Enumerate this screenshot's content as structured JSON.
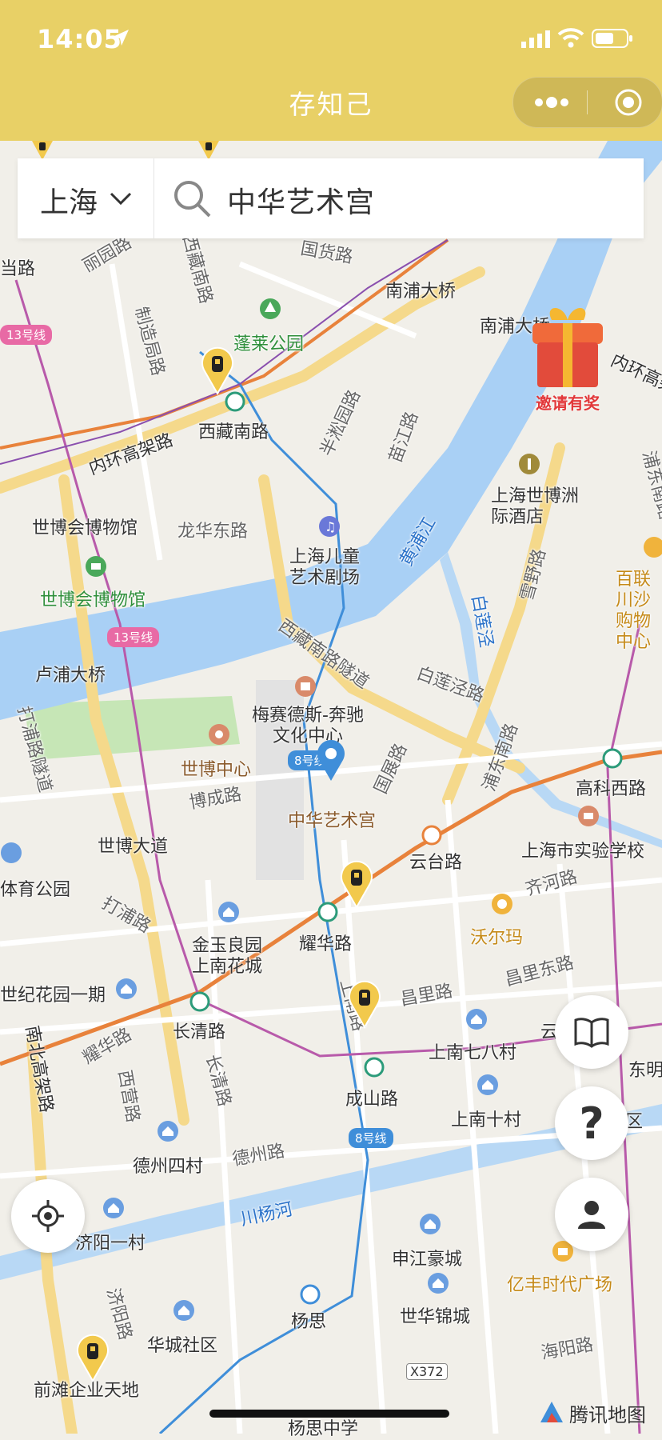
{
  "status_bar": {
    "time": "14:05"
  },
  "title_bar": {
    "title": "存知己"
  },
  "search": {
    "city": "上海",
    "query": "中华艺术宫"
  },
  "promo": {
    "label": "邀请有奖"
  },
  "map": {
    "attribution": "腾讯地图",
    "labels": {
      "dangpan": "当路",
      "liyuan": "丽园路",
      "zhizao": "制造局路",
      "xizang_nan": "西藏南路",
      "penglai": "蓬莱公园",
      "guohuo": "国货路",
      "nanpu_bridge": "南浦大桥",
      "nanpu_bridge2": "南浦大桥",
      "banjing": "半淞园路",
      "yuanjiang": "苗江路",
      "neihuan": "内环高架路",
      "neihuan2": "内环高架",
      "xizang_station": "西藏南路",
      "shibo_museum_a": "世博会博物馆",
      "longhua_e": "龙华东路",
      "shibo_museum_b": "世博会博物馆",
      "huangpu": "黄浦江",
      "children_theatre": "上海儿童艺术剧场",
      "expo_hotel": "上海世博洲际酒店",
      "xueye": "雪野路",
      "bailianjing_r": "白莲泾",
      "puneast": "浦东南路",
      "bailianjing_road": "白莲泾路",
      "lupu": "卢浦大桥",
      "xizang_tunnel": "西藏南路隧道",
      "benz": "梅赛德斯-奔驰文化中心",
      "shibo_center": "世博中心",
      "bocheng": "博成路",
      "guozhan": "国展路",
      "china_art": "中华艺术宫",
      "shibo_ave": "世博大道",
      "yuntai": "云台路",
      "gaoke": "高科西路",
      "exp_school": "上海市实验学校",
      "qihe": "齐河路",
      "dapu": "打浦路",
      "jinyu": "金玉良园",
      "shangnan_garden": "上南花城",
      "yaohua": "耀华路",
      "walmart": "沃尔玛",
      "changqing": "长清路",
      "shiji": "世纪花园一期",
      "changli": "昌里路",
      "changli_e": "昌里东路",
      "shangnan_rd": "上南路",
      "shangnan_8": "上南七八村",
      "yaohua_rd": "耀华路",
      "nanbei": "南北高架路",
      "changqing_rd": "长清路",
      "xiying": "西营路",
      "chengshan": "成山路",
      "shangnan_10": "上南十村",
      "dezhou_4": "德州四村",
      "dezhou_rd": "德州路",
      "chuanyang": "川杨河",
      "jiyang_1": "济阳一村",
      "shenjiang": "申江豪城",
      "yifeng": "亿丰时代广场",
      "jiyang_rd": "济阳路",
      "huacheng": "华城社区",
      "yangsi": "杨思",
      "shicheng": "世华锦城",
      "haiyang": "海阳路",
      "qiantan": "前滩企业天地",
      "x372": "X372",
      "yangsi_school": "杨思中学",
      "lupu_tunnel": "打浦路隧道",
      "sports_park": "体育公园",
      "bailian": "百联川沙购物中心",
      "dongming": "东明",
      "yun": "云",
      "qu": "区",
      "baiyun": "高科西路"
    },
    "badges": {
      "line13_a": "13号线",
      "line13_b": "13号线",
      "line8_a": "8号线",
      "line8_b": "8号线"
    }
  },
  "controls": {
    "locate": "locate-icon",
    "guide": "book-icon",
    "help": "help-icon",
    "profile": "user-icon"
  },
  "colors": {
    "title_bar": "#e8d066",
    "river": "#a9d0f5",
    "metro_8": "#3f8ed9",
    "pin": "#f2c94c"
  }
}
